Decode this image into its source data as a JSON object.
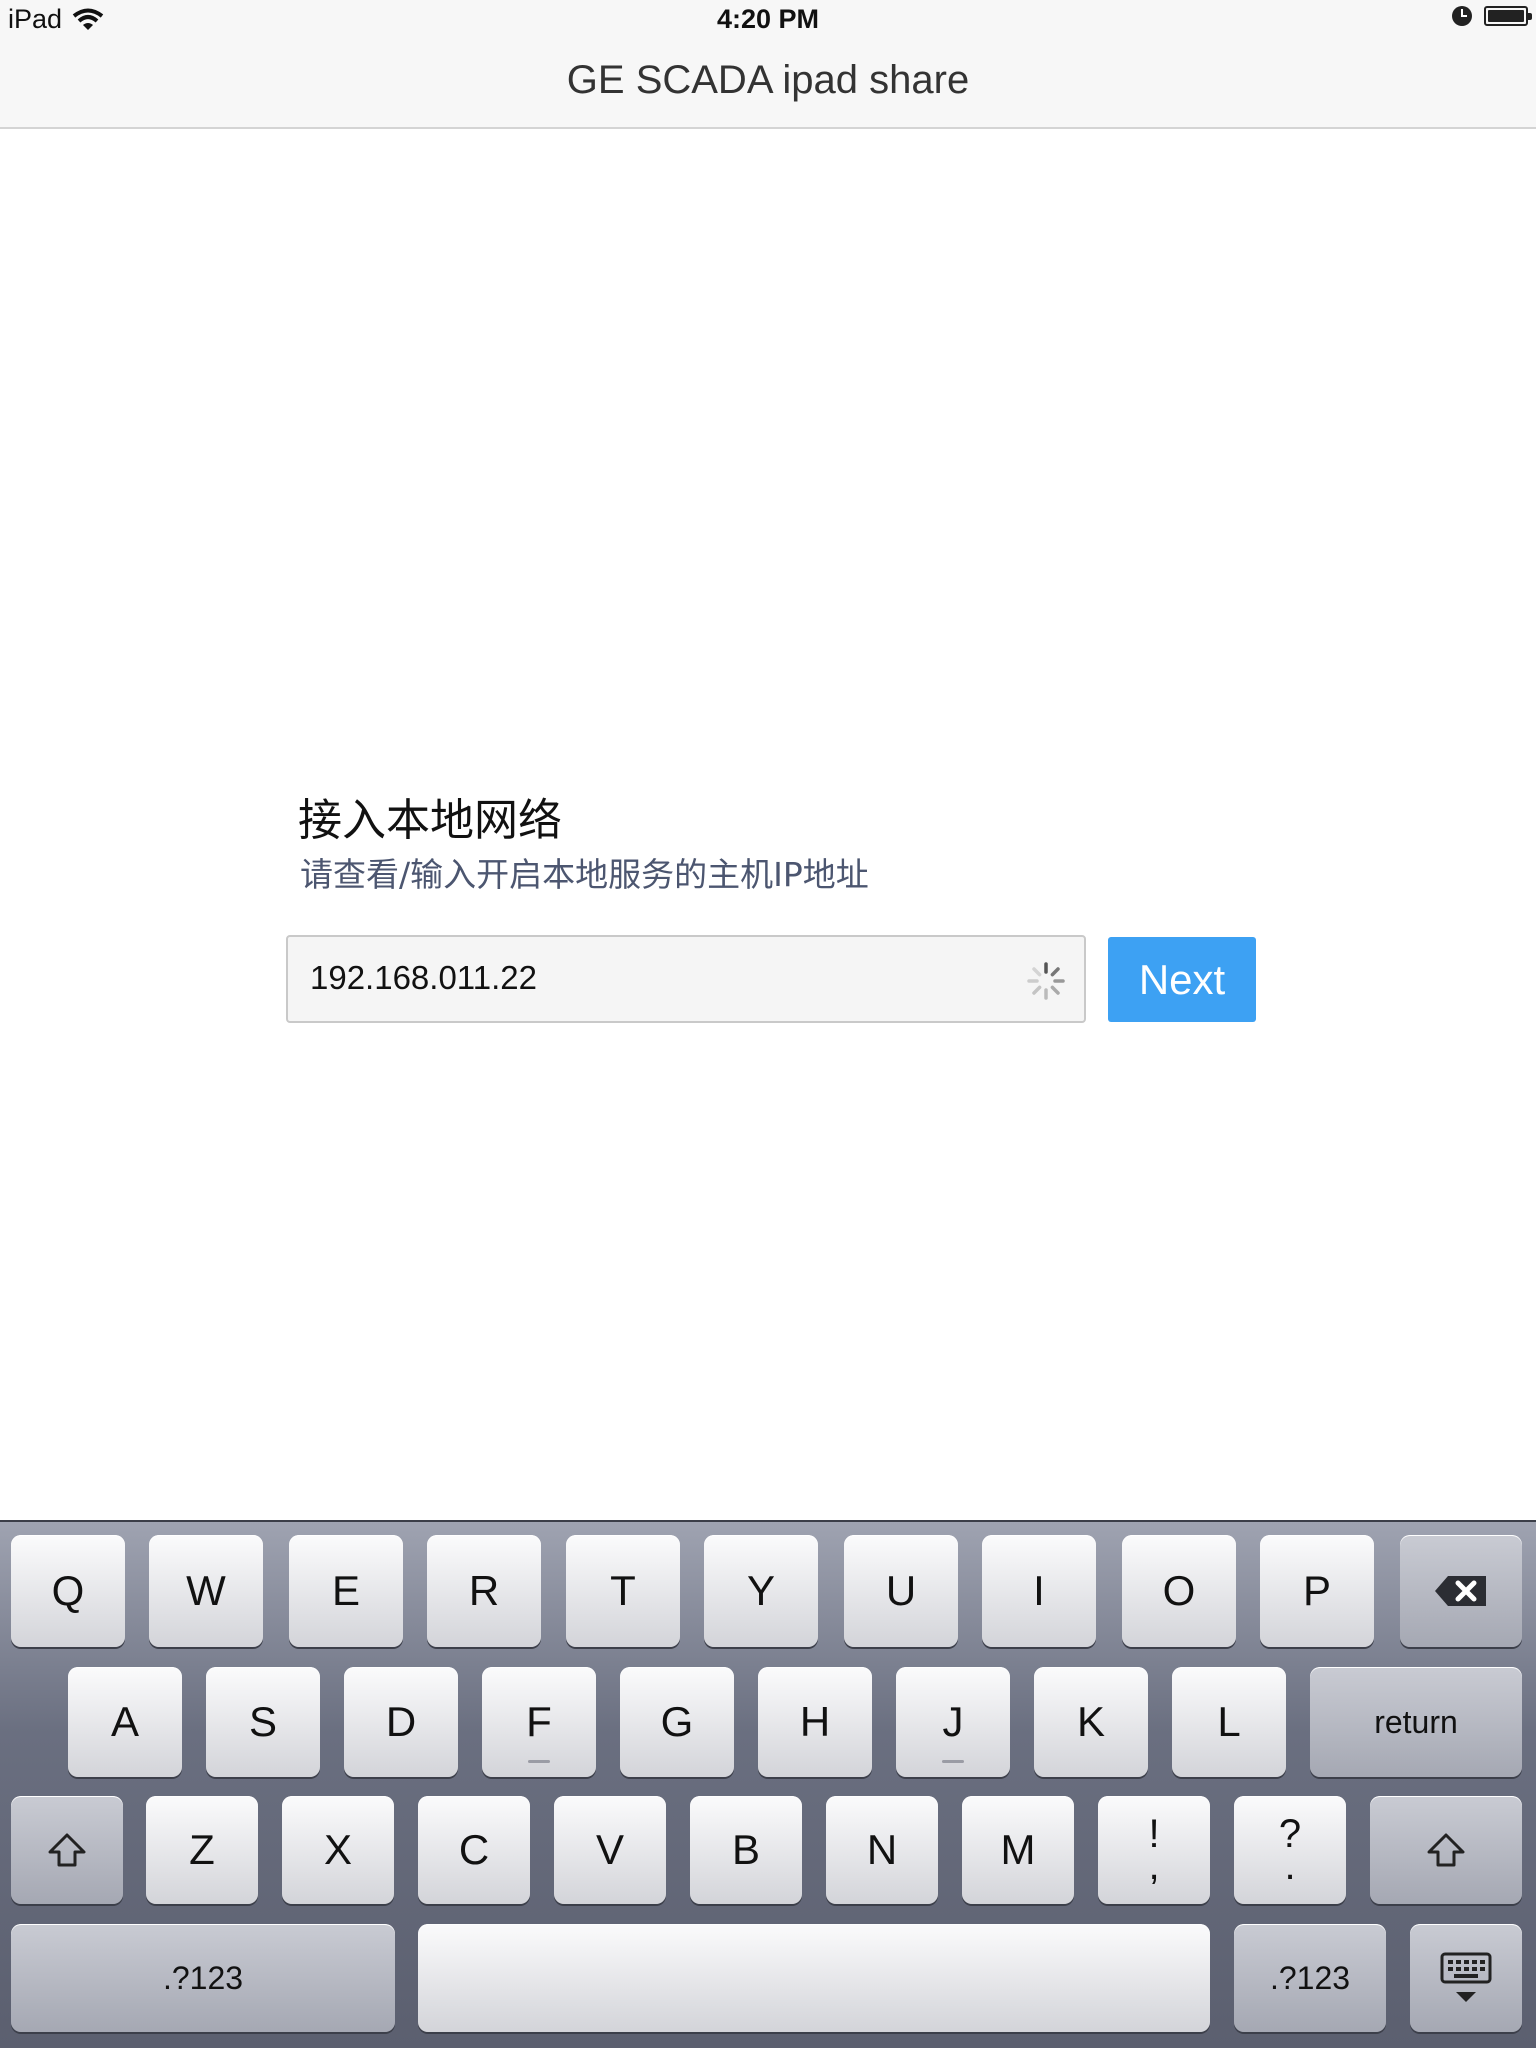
{
  "status_bar": {
    "device": "iPad",
    "time": "4:20 PM",
    "icons": [
      "wifi-icon",
      "clock-icon",
      "battery-icon"
    ]
  },
  "navbar": {
    "title": "GE SCADA ipad share"
  },
  "form": {
    "heading": "接入本地网络",
    "subheading": "请查看/输入开启本地服务的主机IP地址",
    "ip_value": "192.168.011.22",
    "next_label": "Next"
  },
  "keyboard": {
    "row1": [
      "Q",
      "W",
      "E",
      "R",
      "T",
      "Y",
      "U",
      "I",
      "O",
      "P"
    ],
    "row2": [
      "A",
      "S",
      "D",
      "F",
      "G",
      "H",
      "J",
      "K",
      "L"
    ],
    "return_label": "return",
    "row3": [
      "Z",
      "X",
      "C",
      "V",
      "B",
      "N",
      "M"
    ],
    "punct1": [
      "!",
      ","
    ],
    "punct2": [
      "?",
      "."
    ],
    "mode_label_left": ".?123",
    "mode_label_right": ".?123",
    "icons": [
      "backspace-icon",
      "shift-icon",
      "hide-keyboard-icon"
    ]
  },
  "colors": {
    "accent": "#3da1f3",
    "subtitle": "#4c5670",
    "bar": "#f7f7f7"
  }
}
